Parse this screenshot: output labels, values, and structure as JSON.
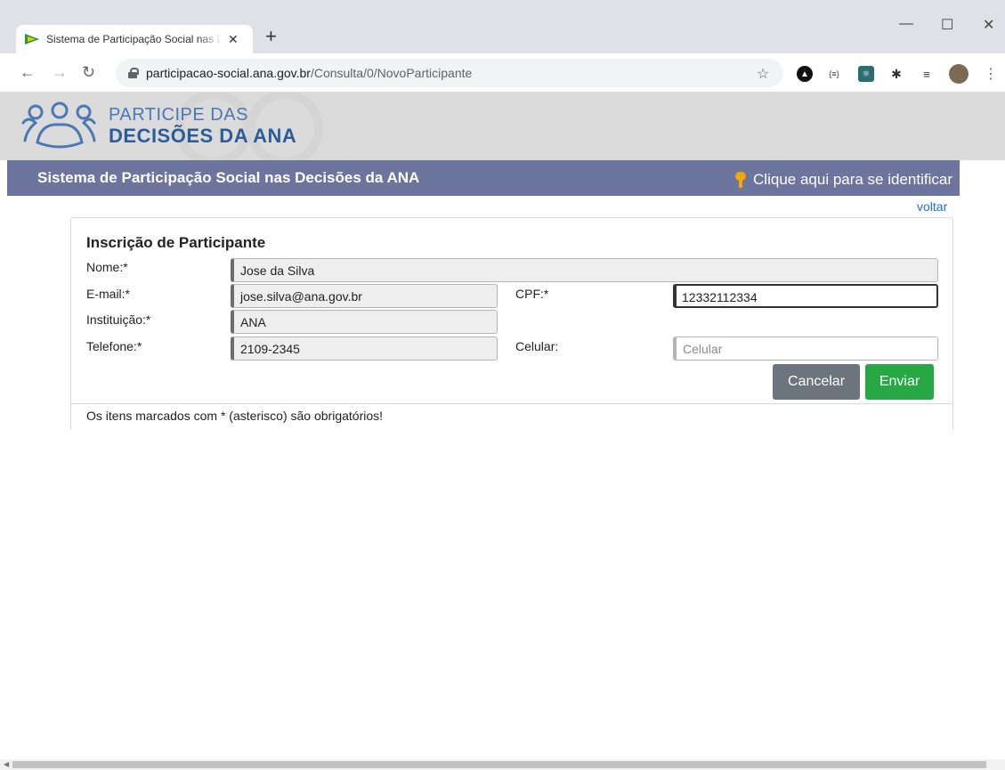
{
  "browser": {
    "tab_title": "Sistema de Participação Social nas Decisões da ANA",
    "tab_close": "✕",
    "new_tab": "+",
    "window_controls": {
      "minimize": "—",
      "maximize": "☐",
      "close": "✕"
    },
    "url_host": "participacao-social.ana.gov.br",
    "url_path": "/Consulta/0/NovoParticipante"
  },
  "header": {
    "logo_line1": "PARTICIPE DAS",
    "logo_line2": "DECISÕES DA ANA",
    "system_title": "Sistema de Participação Social nas Decisões da ANA",
    "login_link": "Clique aqui para se identificar"
  },
  "page": {
    "back_link": "voltar"
  },
  "form": {
    "title": "Inscrição de Participante",
    "nome": {
      "label": "Nome:*",
      "value": "Jose da Silva"
    },
    "email": {
      "label": "E-mail:*",
      "value": "jose.silva@ana.gov.br"
    },
    "cpf": {
      "label": "CPF:*",
      "value": "12332112334"
    },
    "instituicao": {
      "label": "Instituição:*",
      "value": "ANA"
    },
    "telefone": {
      "label": "Telefone:*",
      "value": "2109-2345"
    },
    "celular": {
      "label": "Celular:",
      "placeholder": "Celular",
      "value": ""
    },
    "cancel_label": "Cancelar",
    "submit_label": "Enviar",
    "footer_note": "Os itens marcados com * (asterisco) são obrigatórios!"
  },
  "colors": {
    "header_bar": "#6c759e",
    "cancel_button": "#6c757d",
    "submit_button": "#28a745",
    "link": "#1e6fc7"
  }
}
